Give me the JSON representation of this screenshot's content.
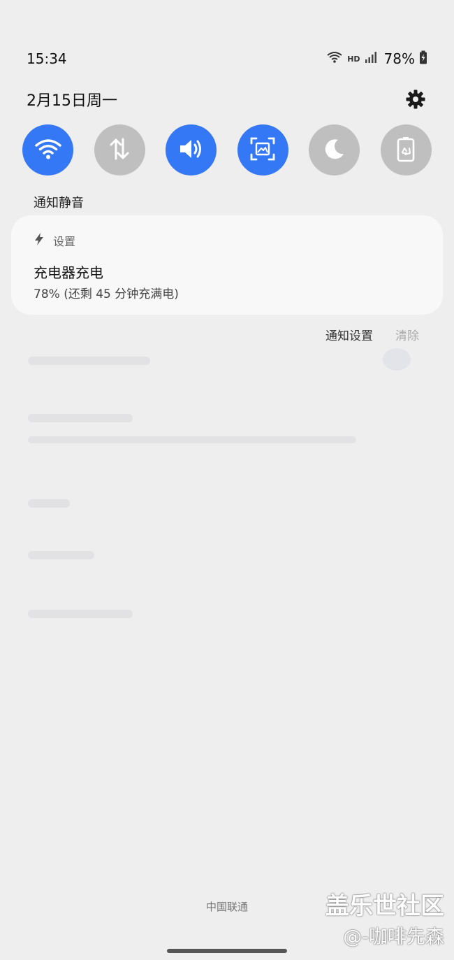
{
  "status_bar": {
    "time": "15:34",
    "network_badge": "HD",
    "battery_percent": "78%",
    "icons": [
      "wifi-icon",
      "signal-icon",
      "battery-charging-icon"
    ]
  },
  "header": {
    "date": "2月15日周一",
    "settings_icon": "gear-icon"
  },
  "quick_toggles": [
    {
      "name": "wifi",
      "icon": "wifi-icon",
      "on": true
    },
    {
      "name": "mobile-data",
      "icon": "data-arrows-icon",
      "on": false
    },
    {
      "name": "sound",
      "icon": "speaker-icon",
      "on": true
    },
    {
      "name": "screenshot",
      "icon": "screenshot-icon",
      "on": true
    },
    {
      "name": "night-mode",
      "icon": "moon-icon",
      "on": false
    },
    {
      "name": "power-saving",
      "icon": "battery-recycle-icon",
      "on": false
    }
  ],
  "section_label": "通知静音",
  "notification": {
    "app_name": "设置",
    "app_icon": "bolt-icon",
    "title": "充电器充电",
    "body": "78% (还剩 45 分钟充满电)"
  },
  "actions": {
    "settings": "通知设置",
    "clear": "清除"
  },
  "carrier": "中国联通",
  "watermark": {
    "line1": "盖乐世社区",
    "line2": "@-咖啡先森"
  },
  "colors": {
    "accent": "#3478f6",
    "toggle_off": "#bfbfbf",
    "background": "#eeeeef",
    "card": "#f8f8f8"
  }
}
